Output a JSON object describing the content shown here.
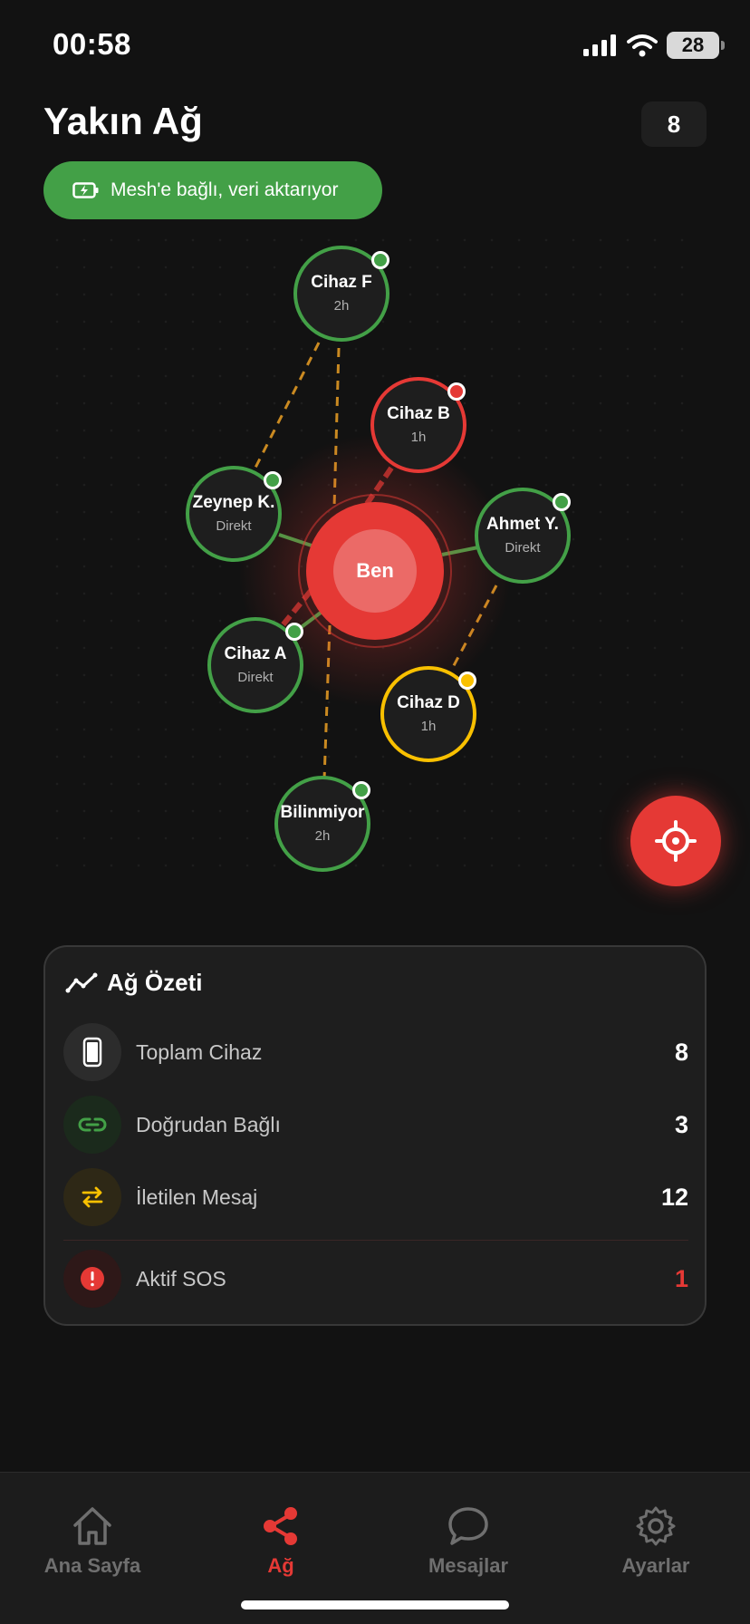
{
  "status": {
    "time": "00:58",
    "battery": "28"
  },
  "header": {
    "title": "Yakın Ağ",
    "count_badge": "8"
  },
  "mesh_status": {
    "label": "Mesh'e bağlı, veri aktarıyor",
    "icon": "battery-charging-icon"
  },
  "graph": {
    "me": {
      "label": "Ben"
    },
    "nodes": [
      {
        "id": "cihaz-f",
        "name": "Cihaz F",
        "sub": "2h",
        "status": "green"
      },
      {
        "id": "cihaz-b",
        "name": "Cihaz B",
        "sub": "1h",
        "status": "red"
      },
      {
        "id": "zeynep",
        "name": "Zeynep K.",
        "sub": "Direkt",
        "status": "green"
      },
      {
        "id": "ahmet",
        "name": "Ahmet Y.",
        "sub": "Direkt",
        "status": "green"
      },
      {
        "id": "cihaz-a",
        "name": "Cihaz A",
        "sub": "Direkt",
        "status": "green"
      },
      {
        "id": "cihaz-d",
        "name": "Cihaz D",
        "sub": "1h",
        "status": "yellow"
      },
      {
        "id": "bilinmiyor",
        "name": "Bilinmiyor",
        "sub": "2h",
        "status": "green"
      }
    ]
  },
  "summary": {
    "title": "Ağ Özeti",
    "rows": [
      {
        "label": "Toplam Cihaz",
        "value": "8",
        "icon": "phone-icon"
      },
      {
        "label": "Doğrudan Bağlı",
        "value": "3",
        "icon": "link-icon"
      },
      {
        "label": "İletilen Mesaj",
        "value": "12",
        "icon": "transfer-icon"
      },
      {
        "label": "Aktif SOS",
        "value": "1",
        "icon": "alert-icon"
      }
    ]
  },
  "tabs": [
    {
      "label": "Ana Sayfa",
      "icon": "home-icon",
      "active": false
    },
    {
      "label": "Ağ",
      "icon": "share-icon",
      "active": true
    },
    {
      "label": "Mesajlar",
      "icon": "chat-icon",
      "active": false
    },
    {
      "label": "Ayarlar",
      "icon": "gear-icon",
      "active": false
    }
  ],
  "colors": {
    "accent": "#e53935",
    "green": "#43a047",
    "yellow": "#f9c000",
    "background": "#121212"
  }
}
